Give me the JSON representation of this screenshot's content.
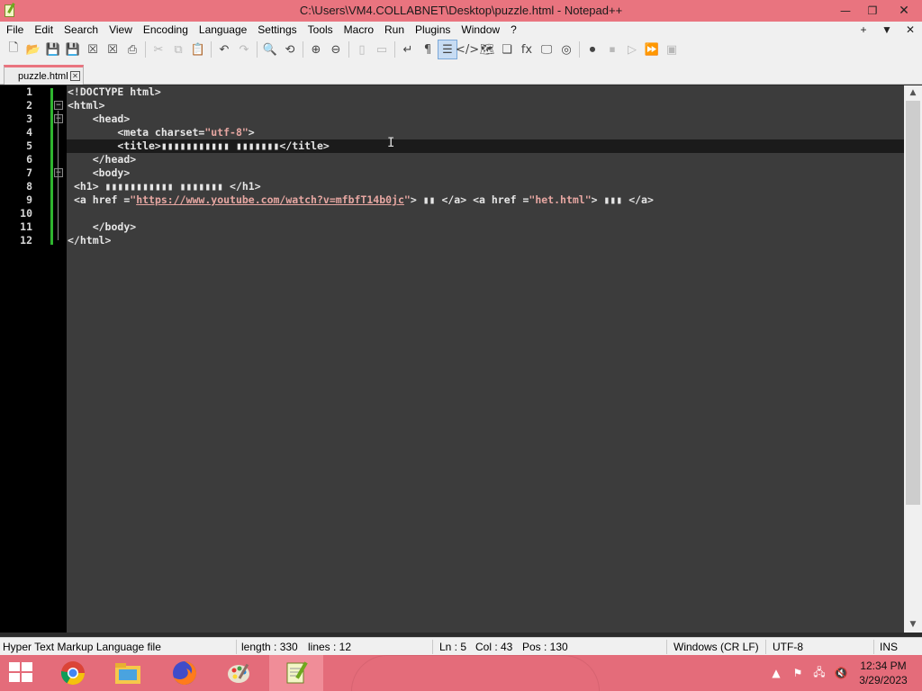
{
  "window": {
    "title": "C:\\Users\\VM4.COLLABNET\\Desktop\\puzzle.html - Notepad++",
    "minimize_glyph": "—",
    "restore_glyph": "❐",
    "close_glyph": "✕"
  },
  "menu": {
    "items": [
      "File",
      "Edit",
      "Search",
      "View",
      "Encoding",
      "Language",
      "Settings",
      "Tools",
      "Macro",
      "Run",
      "Plugins",
      "Window",
      "?"
    ],
    "right": {
      "plus": "+",
      "dropdown": "▼",
      "close": "✕"
    }
  },
  "toolbar": {
    "icons": [
      {
        "name": "new-file-icon",
        "glyph": "🗋",
        "state": "normal"
      },
      {
        "name": "open-file-icon",
        "glyph": "📂",
        "state": "normal"
      },
      {
        "name": "save-icon",
        "glyph": "💾",
        "state": "disabled"
      },
      {
        "name": "save-all-icon",
        "glyph": "💾",
        "state": "disabled"
      },
      {
        "name": "close-file-icon",
        "glyph": "☒",
        "state": "normal"
      },
      {
        "name": "close-all-icon",
        "glyph": "☒",
        "state": "normal"
      },
      {
        "name": "print-icon",
        "glyph": "⎙",
        "state": "normal"
      },
      {
        "name": "sep"
      },
      {
        "name": "cut-icon",
        "glyph": "✂",
        "state": "disabled"
      },
      {
        "name": "copy-icon",
        "glyph": "⧉",
        "state": "disabled"
      },
      {
        "name": "paste-icon",
        "glyph": "📋",
        "state": "normal"
      },
      {
        "name": "sep"
      },
      {
        "name": "undo-icon",
        "glyph": "↶",
        "state": "normal"
      },
      {
        "name": "redo-icon",
        "glyph": "↷",
        "state": "disabled"
      },
      {
        "name": "sep"
      },
      {
        "name": "find-icon",
        "glyph": "🔍",
        "state": "normal"
      },
      {
        "name": "replace-icon",
        "glyph": "⟲",
        "state": "normal"
      },
      {
        "name": "sep"
      },
      {
        "name": "zoom-in-icon",
        "glyph": "⊕",
        "state": "normal"
      },
      {
        "name": "zoom-out-icon",
        "glyph": "⊖",
        "state": "normal"
      },
      {
        "name": "sep"
      },
      {
        "name": "sync-vertical-icon",
        "glyph": "▯",
        "state": "disabled"
      },
      {
        "name": "sync-horizontal-icon",
        "glyph": "▭",
        "state": "disabled"
      },
      {
        "name": "sep"
      },
      {
        "name": "word-wrap-icon",
        "glyph": "↵",
        "state": "normal"
      },
      {
        "name": "show-all-chars-icon",
        "glyph": "¶",
        "state": "normal"
      },
      {
        "name": "indent-guide-icon",
        "glyph": "☰",
        "state": "active"
      },
      {
        "name": "html-tag-icon",
        "glyph": "</>",
        "state": "normal"
      },
      {
        "name": "document-map-icon",
        "glyph": "🗺",
        "state": "normal"
      },
      {
        "name": "document-list-icon",
        "glyph": "❏",
        "state": "normal"
      },
      {
        "name": "function-list-icon",
        "glyph": "fx",
        "state": "normal"
      },
      {
        "name": "folder-workspace-icon",
        "glyph": "🖵",
        "state": "normal"
      },
      {
        "name": "monitoring-icon",
        "glyph": "◎",
        "state": "normal"
      },
      {
        "name": "sep"
      },
      {
        "name": "record-macro-icon",
        "glyph": "⏺",
        "state": "normal"
      },
      {
        "name": "stop-record-icon",
        "glyph": "⏹",
        "state": "disabled"
      },
      {
        "name": "play-macro-icon",
        "glyph": "▷",
        "state": "disabled"
      },
      {
        "name": "run-macro-multiple-icon",
        "glyph": "⏩",
        "state": "normal"
      },
      {
        "name": "save-macro-icon",
        "glyph": "▣",
        "state": "disabled"
      }
    ]
  },
  "tab": {
    "label": "puzzle.html",
    "close": "✕"
  },
  "editor": {
    "lines": [
      {
        "n": "1",
        "html": "<span class=\"t\">&lt;!DOCTYPE html&gt;</span>"
      },
      {
        "n": "2",
        "html": "<span class=\"t\">&lt;html&gt;</span>"
      },
      {
        "n": "3",
        "html": "    <span class=\"t\">&lt;head&gt;</span>"
      },
      {
        "n": "4",
        "html": "        <span class=\"t\">&lt;meta charset=</span><span class=\"s\">\"utf-8\"</span><span class=\"t\">&gt;</span>"
      },
      {
        "n": "5",
        "html": "        <span class=\"t\">&lt;title&gt;▮▮▮▮▮▮▮▮▮▮▮ ▮▮▮▮▮▮▮&lt;/title&gt;</span>"
      },
      {
        "n": "6",
        "html": "    <span class=\"t\">&lt;/head&gt;</span>"
      },
      {
        "n": "7",
        "html": "    <span class=\"t\">&lt;body&gt;</span>"
      },
      {
        "n": "8",
        "html": " <span class=\"t\">&lt;h1&gt; ▮▮▮▮▮▮▮▮▮▮▮ ▮▮▮▮▮▮▮ &lt;/h1&gt;</span>"
      },
      {
        "n": "9",
        "html": " <span class=\"t\">&lt;a href =</span><span class=\"s\">\"</span><span class=\"u\">https://www.youtube.com/watch?v=mfbfT14b0jc</span><span class=\"s\">\"</span><span class=\"t\">&gt; ▮▮ &lt;/a&gt; &lt;a href =</span><span class=\"s\">\"het.html\"</span><span class=\"t\">&gt; ▮▮▮ &lt;/a&gt;</span>"
      },
      {
        "n": "10",
        "html": ""
      },
      {
        "n": "11",
        "html": "    <span class=\"t\">&lt;/body&gt;</span>"
      },
      {
        "n": "12",
        "html": "<span class=\"t\">&lt;/html&gt;</span>"
      }
    ],
    "current_line": 5,
    "fold_open": [
      2,
      3,
      7
    ],
    "ibeam": "I"
  },
  "status": {
    "file_type": "Hyper Text Markup Language file",
    "length": "length : 330",
    "lines": "lines : 12",
    "ln": "Ln : 5",
    "col": "Col : 43",
    "pos": "Pos : 130",
    "eol": "Windows (CR LF)",
    "encoding": "UTF-8",
    "mode": "INS"
  },
  "taskbar": {
    "apps": [
      {
        "name": "chrome-taskbar-icon"
      },
      {
        "name": "file-explorer-taskbar-icon"
      },
      {
        "name": "firefox-taskbar-icon"
      },
      {
        "name": "paint-taskbar-icon"
      },
      {
        "name": "notepadpp-taskbar-icon"
      }
    ],
    "tray": {
      "chevron": "▲",
      "flag": "⚑",
      "network": "🖧",
      "volume": "🔇"
    },
    "time": "12:34 PM",
    "date": "3/29/2023"
  }
}
